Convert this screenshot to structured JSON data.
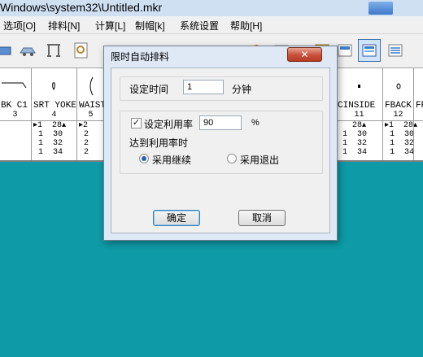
{
  "window": {
    "title": "Windows\\system32\\Untitled.mkr"
  },
  "menu": [
    "选项[O]",
    "排料[N]",
    "计算[L]",
    "制帽[k]",
    "系统设置",
    "帮助[H]"
  ],
  "toolbar_icons": [
    "ruler-icon",
    "car-icon",
    "rack-icon",
    "magnify-page-icon",
    "pie-icon",
    "grid-icon",
    "stack-icon",
    "view-icon",
    "view-selected-icon",
    "list-icon"
  ],
  "pieces": [
    {
      "name": "BK C1",
      "num": "3",
      "rows": [
        "",
        "",
        "",
        ""
      ]
    },
    {
      "name": "SRT YOKE C",
      "num": "4",
      "rows": [
        "▸1  28▴",
        " 1  30",
        " 1  32",
        " 1  34"
      ]
    },
    {
      "name": "WAIST",
      "num": "5",
      "rows": [
        "▸2",
        " 2",
        " 2",
        " 2"
      ]
    },
    {
      "name": "CINSIDE",
      "num": "11",
      "rows": [
        "   28▴",
        " 1  30",
        " 1  32",
        " 1  34"
      ]
    },
    {
      "name": "FBACK",
      "num": "12",
      "rows": [
        "▸1  28▴",
        " 1  30",
        " 1  32",
        " 1  34"
      ]
    },
    {
      "name": "FR",
      "num": "",
      "rows": [
        "",
        "",
        "",
        ""
      ]
    }
  ],
  "dialog": {
    "title": "限时自动排料",
    "close_label": "✕",
    "time_label": "设定时间",
    "time_value": "1",
    "time_unit": "分钟",
    "util_check_label": "设定利用率",
    "util_checked": "✓",
    "util_value": "90",
    "util_unit": "%",
    "reach_label": "达到利用率时",
    "opt_continue": "采用继续",
    "opt_exit": "采用退出",
    "ok_label": "确定",
    "cancel_label": "取消"
  }
}
